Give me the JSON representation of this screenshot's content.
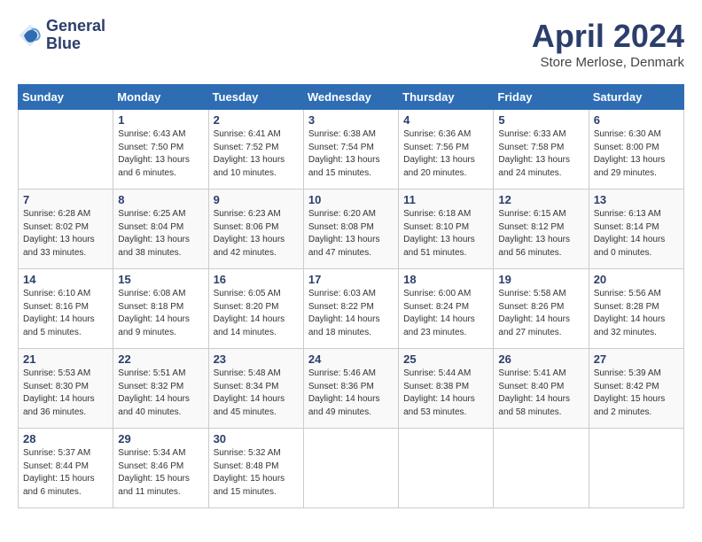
{
  "header": {
    "logo_line1": "General",
    "logo_line2": "Blue",
    "month_title": "April 2024",
    "location": "Store Merlose, Denmark"
  },
  "weekdays": [
    "Sunday",
    "Monday",
    "Tuesday",
    "Wednesday",
    "Thursday",
    "Friday",
    "Saturday"
  ],
  "weeks": [
    [
      {
        "num": "",
        "info": ""
      },
      {
        "num": "1",
        "info": "Sunrise: 6:43 AM\nSunset: 7:50 PM\nDaylight: 13 hours\nand 6 minutes."
      },
      {
        "num": "2",
        "info": "Sunrise: 6:41 AM\nSunset: 7:52 PM\nDaylight: 13 hours\nand 10 minutes."
      },
      {
        "num": "3",
        "info": "Sunrise: 6:38 AM\nSunset: 7:54 PM\nDaylight: 13 hours\nand 15 minutes."
      },
      {
        "num": "4",
        "info": "Sunrise: 6:36 AM\nSunset: 7:56 PM\nDaylight: 13 hours\nand 20 minutes."
      },
      {
        "num": "5",
        "info": "Sunrise: 6:33 AM\nSunset: 7:58 PM\nDaylight: 13 hours\nand 24 minutes."
      },
      {
        "num": "6",
        "info": "Sunrise: 6:30 AM\nSunset: 8:00 PM\nDaylight: 13 hours\nand 29 minutes."
      }
    ],
    [
      {
        "num": "7",
        "info": "Sunrise: 6:28 AM\nSunset: 8:02 PM\nDaylight: 13 hours\nand 33 minutes."
      },
      {
        "num": "8",
        "info": "Sunrise: 6:25 AM\nSunset: 8:04 PM\nDaylight: 13 hours\nand 38 minutes."
      },
      {
        "num": "9",
        "info": "Sunrise: 6:23 AM\nSunset: 8:06 PM\nDaylight: 13 hours\nand 42 minutes."
      },
      {
        "num": "10",
        "info": "Sunrise: 6:20 AM\nSunset: 8:08 PM\nDaylight: 13 hours\nand 47 minutes."
      },
      {
        "num": "11",
        "info": "Sunrise: 6:18 AM\nSunset: 8:10 PM\nDaylight: 13 hours\nand 51 minutes."
      },
      {
        "num": "12",
        "info": "Sunrise: 6:15 AM\nSunset: 8:12 PM\nDaylight: 13 hours\nand 56 minutes."
      },
      {
        "num": "13",
        "info": "Sunrise: 6:13 AM\nSunset: 8:14 PM\nDaylight: 14 hours\nand 0 minutes."
      }
    ],
    [
      {
        "num": "14",
        "info": "Sunrise: 6:10 AM\nSunset: 8:16 PM\nDaylight: 14 hours\nand 5 minutes."
      },
      {
        "num": "15",
        "info": "Sunrise: 6:08 AM\nSunset: 8:18 PM\nDaylight: 14 hours\nand 9 minutes."
      },
      {
        "num": "16",
        "info": "Sunrise: 6:05 AM\nSunset: 8:20 PM\nDaylight: 14 hours\nand 14 minutes."
      },
      {
        "num": "17",
        "info": "Sunrise: 6:03 AM\nSunset: 8:22 PM\nDaylight: 14 hours\nand 18 minutes."
      },
      {
        "num": "18",
        "info": "Sunrise: 6:00 AM\nSunset: 8:24 PM\nDaylight: 14 hours\nand 23 minutes."
      },
      {
        "num": "19",
        "info": "Sunrise: 5:58 AM\nSunset: 8:26 PM\nDaylight: 14 hours\nand 27 minutes."
      },
      {
        "num": "20",
        "info": "Sunrise: 5:56 AM\nSunset: 8:28 PM\nDaylight: 14 hours\nand 32 minutes."
      }
    ],
    [
      {
        "num": "21",
        "info": "Sunrise: 5:53 AM\nSunset: 8:30 PM\nDaylight: 14 hours\nand 36 minutes."
      },
      {
        "num": "22",
        "info": "Sunrise: 5:51 AM\nSunset: 8:32 PM\nDaylight: 14 hours\nand 40 minutes."
      },
      {
        "num": "23",
        "info": "Sunrise: 5:48 AM\nSunset: 8:34 PM\nDaylight: 14 hours\nand 45 minutes."
      },
      {
        "num": "24",
        "info": "Sunrise: 5:46 AM\nSunset: 8:36 PM\nDaylight: 14 hours\nand 49 minutes."
      },
      {
        "num": "25",
        "info": "Sunrise: 5:44 AM\nSunset: 8:38 PM\nDaylight: 14 hours\nand 53 minutes."
      },
      {
        "num": "26",
        "info": "Sunrise: 5:41 AM\nSunset: 8:40 PM\nDaylight: 14 hours\nand 58 minutes."
      },
      {
        "num": "27",
        "info": "Sunrise: 5:39 AM\nSunset: 8:42 PM\nDaylight: 15 hours\nand 2 minutes."
      }
    ],
    [
      {
        "num": "28",
        "info": "Sunrise: 5:37 AM\nSunset: 8:44 PM\nDaylight: 15 hours\nand 6 minutes."
      },
      {
        "num": "29",
        "info": "Sunrise: 5:34 AM\nSunset: 8:46 PM\nDaylight: 15 hours\nand 11 minutes."
      },
      {
        "num": "30",
        "info": "Sunrise: 5:32 AM\nSunset: 8:48 PM\nDaylight: 15 hours\nand 15 minutes."
      },
      {
        "num": "",
        "info": ""
      },
      {
        "num": "",
        "info": ""
      },
      {
        "num": "",
        "info": ""
      },
      {
        "num": "",
        "info": ""
      }
    ]
  ]
}
